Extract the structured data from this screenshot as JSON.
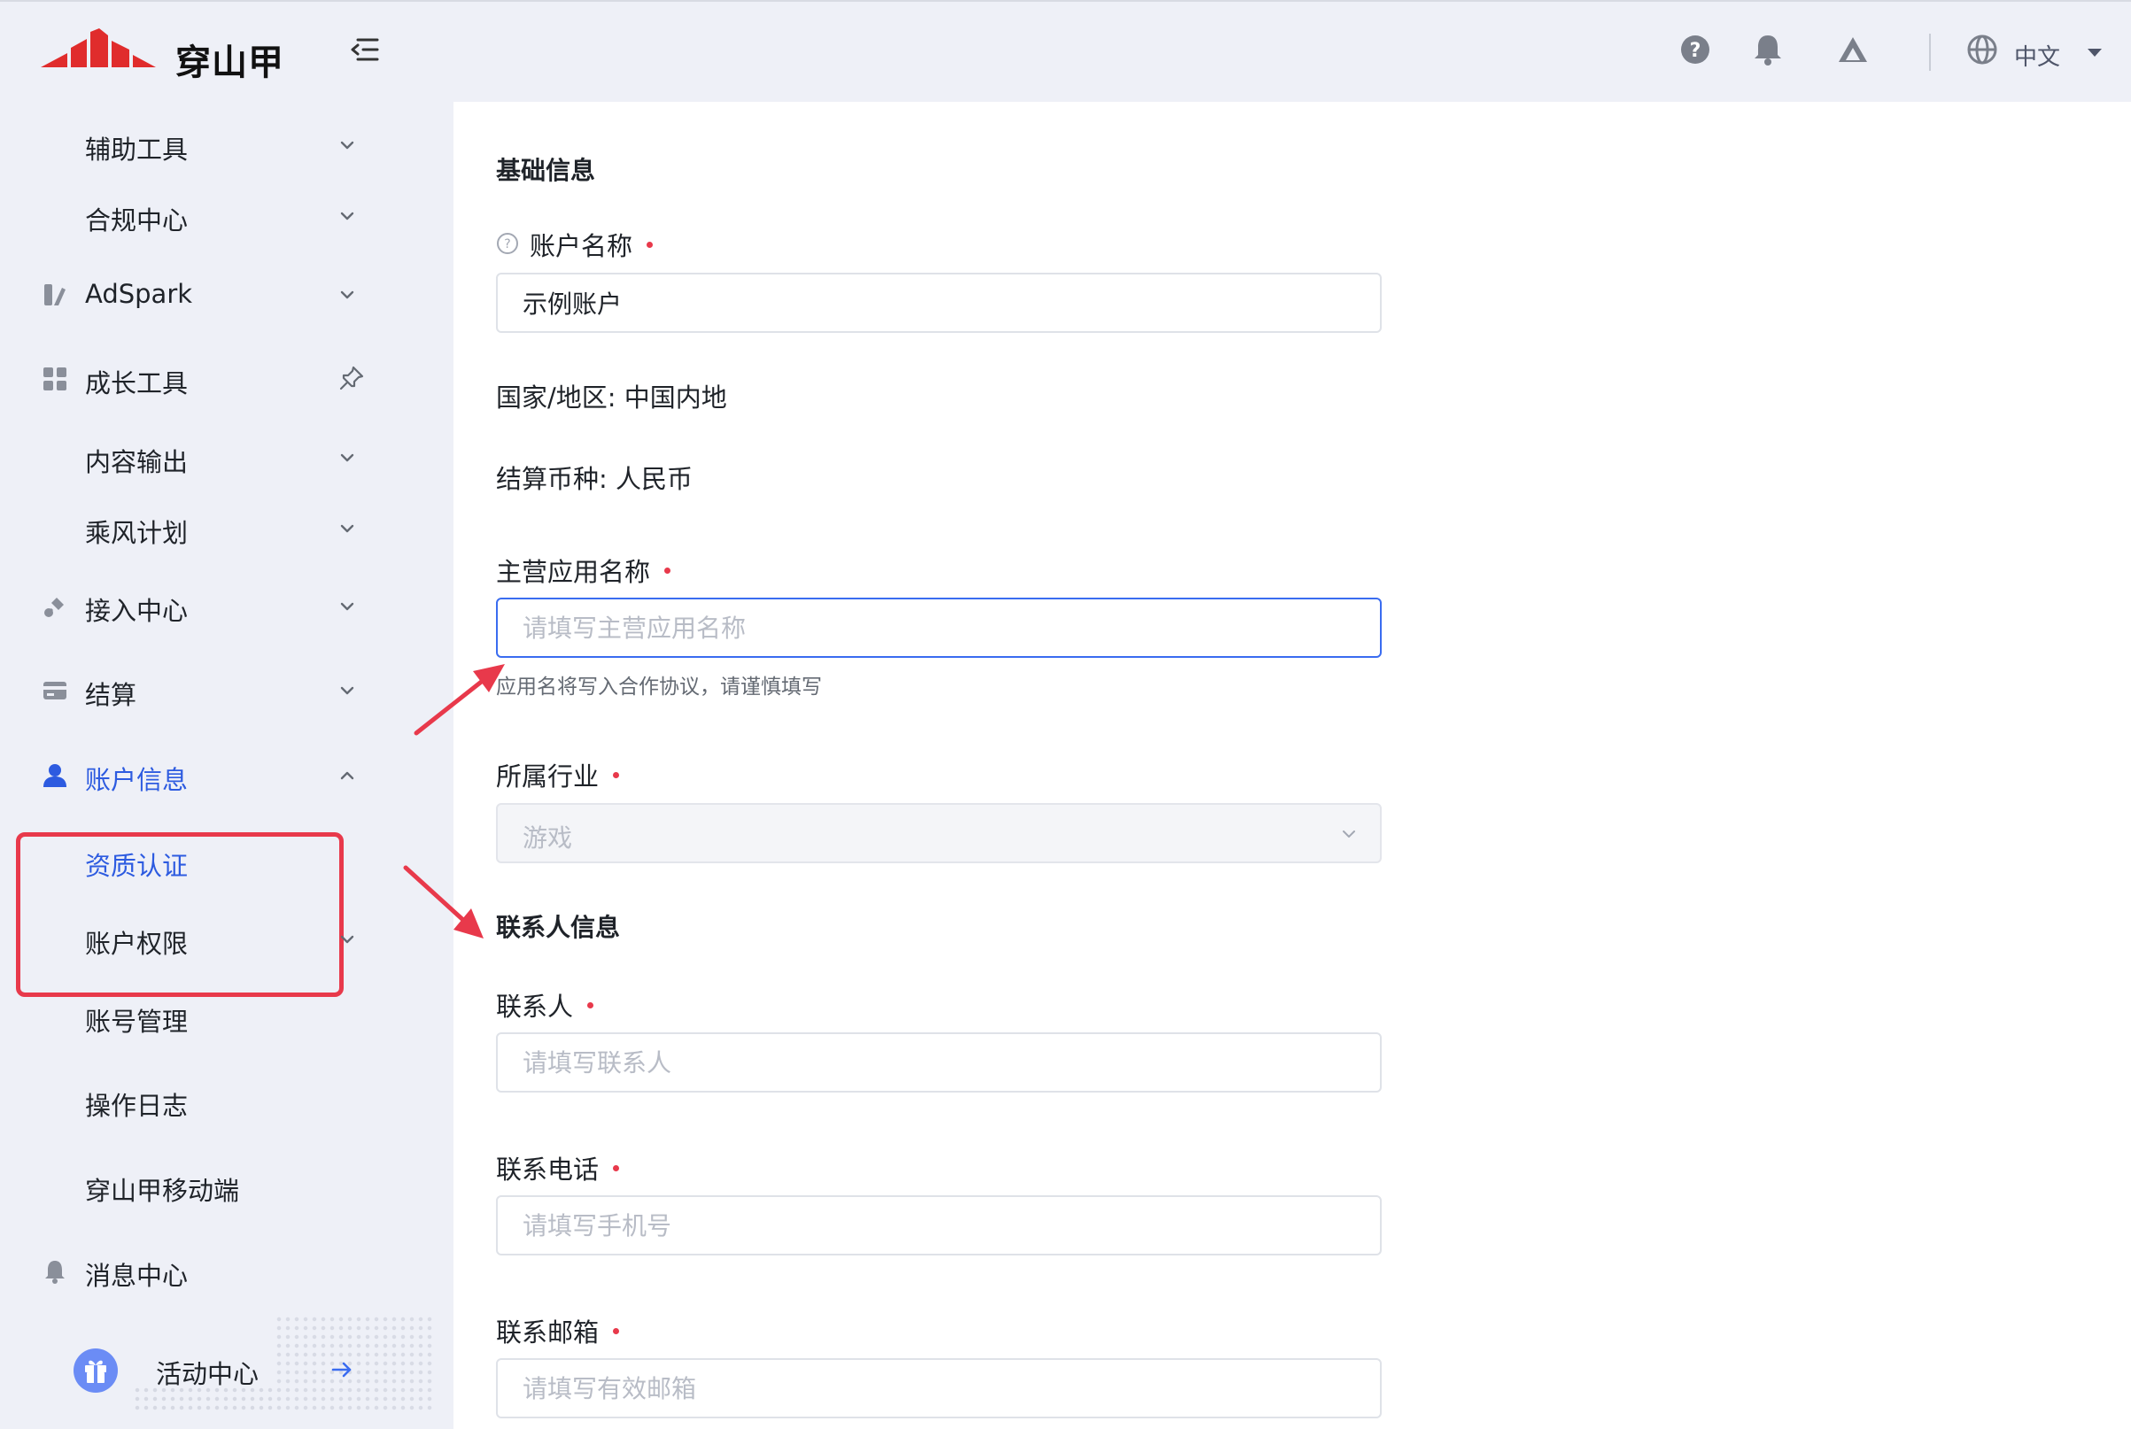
{
  "header": {
    "brand_name": "穿山甲",
    "language_label": "中文"
  },
  "sidebar": {
    "items": [
      {
        "label": "辅助工具"
      },
      {
        "label": "合规中心"
      },
      {
        "label": "AdSpark"
      },
      {
        "label": "成长工具"
      },
      {
        "label": "内容输出"
      },
      {
        "label": "乘风计划"
      },
      {
        "label": "接入中心"
      },
      {
        "label": "结算"
      },
      {
        "label": "账户信息"
      },
      {
        "label": "资质认证"
      },
      {
        "label": "账户权限"
      },
      {
        "label": "账号管理"
      },
      {
        "label": "操作日志"
      },
      {
        "label": "穿山甲移动端"
      },
      {
        "label": "消息中心"
      }
    ],
    "activity_label": "活动中心"
  },
  "form": {
    "basic_title": "基础信息",
    "account_name_label": "账户名称",
    "account_name_value": "示例账户",
    "country_text": "国家/地区: 中国内地",
    "currency_text": "结算币种: 人民币",
    "app_name_label": "主营应用名称",
    "app_name_placeholder": "请填写主营应用名称",
    "app_name_hint": "应用名将写入合作协议，请谨慎填写",
    "industry_label": "所属行业",
    "industry_value": "游戏",
    "contact_title": "联系人信息",
    "contact_label": "联系人",
    "contact_placeholder": "请填写联系人",
    "phone_label": "联系电话",
    "phone_placeholder": "请填写手机号",
    "email_label": "联系邮箱",
    "email_placeholder": "请填写有效邮箱"
  },
  "colors": {
    "accent": "#2d5be0",
    "required": "#e8394b",
    "annotation": "#e8394b",
    "focus_border": "#3a6cf0"
  }
}
